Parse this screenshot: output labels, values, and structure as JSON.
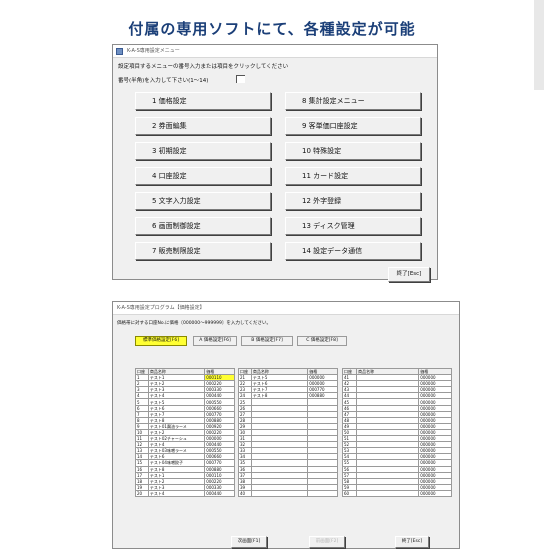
{
  "banner": "付属の専用ソフトにて、各種設定が可能",
  "menu_window": {
    "title": "K-A-S専用設定メニュー",
    "instruction": "設定項目するメニューの番号入力または項目をクリックしてください",
    "number_prompt": "番号(半角)を入力して下さい(1～14)",
    "number_value": "",
    "buttons": [
      {
        "label": "1 価格設定"
      },
      {
        "label": "8 集計設定メニュー"
      },
      {
        "label": "2 券面編集"
      },
      {
        "label": "9 客単価口座設定"
      },
      {
        "label": "3 初期設定"
      },
      {
        "label": "10 特殊設定"
      },
      {
        "label": "4 口座設定"
      },
      {
        "label": "11 カード設定"
      },
      {
        "label": "5 文字入力設定"
      },
      {
        "label": "12 外字登録"
      },
      {
        "label": "6 画面制御設定"
      },
      {
        "label": "13 ディスク管理"
      },
      {
        "label": "7 販売制限設定"
      },
      {
        "label": "14 設定データ通信"
      }
    ],
    "end_button": "終了[Esc]"
  },
  "price_window": {
    "title": "K-A-S専用設定プログラム【価格設定】",
    "instruction": "価格帯に対する口座No.に価格〔000000～999999〕を入力してください。",
    "tabs": [
      {
        "label": "標準価格設定[F6]",
        "active": true
      },
      {
        "label": "A 価格設定[F6]",
        "active": false
      },
      {
        "label": "B 価格設定[F7]",
        "active": false
      },
      {
        "label": "C 価格設定[F8]",
        "active": false
      }
    ],
    "header_label": "口座",
    "columns": [
      "口座",
      "商品名称",
      "価格"
    ],
    "table_left": [
      {
        "no": "1",
        "name": "テスト1",
        "price": "000110",
        "hl": true
      },
      {
        "no": "2",
        "name": "テスト2",
        "price": "000220"
      },
      {
        "no": "3",
        "name": "テスト3",
        "price": "000330"
      },
      {
        "no": "4",
        "name": "テスト4",
        "price": "000440"
      },
      {
        "no": "5",
        "name": "テスト5",
        "price": "000550"
      },
      {
        "no": "6",
        "name": "テスト6",
        "price": "000660"
      },
      {
        "no": "7",
        "name": "テスト7",
        "price": "000770"
      },
      {
        "no": "8",
        "name": "テスト8",
        "price": "000880"
      },
      {
        "no": "9",
        "name": "テスト01醤油ラーメ",
        "price": "000920"
      },
      {
        "no": "10",
        "name": "テスト2",
        "price": "000220"
      },
      {
        "no": "11",
        "name": "テスト02チャーシュ",
        "price": "000000"
      },
      {
        "no": "12",
        "name": "テスト4",
        "price": "000440"
      },
      {
        "no": "13",
        "name": "テスト03味噌ラーメ",
        "price": "000550"
      },
      {
        "no": "14",
        "name": "テスト6",
        "price": "000660"
      },
      {
        "no": "15",
        "name": "テスト04味噌餃子",
        "price": "000770"
      },
      {
        "no": "16",
        "name": "テスト8",
        "price": "000880"
      },
      {
        "no": "17",
        "name": "テスト1",
        "price": "000110"
      },
      {
        "no": "18",
        "name": "テスト2",
        "price": "000220"
      },
      {
        "no": "19",
        "name": "テスト3",
        "price": "000330"
      },
      {
        "no": "20",
        "name": "テスト4",
        "price": "000440"
      }
    ],
    "table_mid": [
      {
        "no": "21",
        "name": "テスト5",
        "price": "000000"
      },
      {
        "no": "22",
        "name": "テスト6",
        "price": "000000"
      },
      {
        "no": "23",
        "name": "テスト7",
        "price": "000770"
      },
      {
        "no": "24",
        "name": "テスト8",
        "price": "000880"
      },
      {
        "no": "25",
        "name": "",
        "price": ""
      },
      {
        "no": "26",
        "name": "",
        "price": ""
      },
      {
        "no": "27",
        "name": "",
        "price": ""
      },
      {
        "no": "28",
        "name": "",
        "price": ""
      },
      {
        "no": "29",
        "name": "",
        "price": ""
      },
      {
        "no": "30",
        "name": "",
        "price": ""
      },
      {
        "no": "31",
        "name": "",
        "price": ""
      },
      {
        "no": "32",
        "name": "",
        "price": ""
      },
      {
        "no": "33",
        "name": "",
        "price": ""
      },
      {
        "no": "34",
        "name": "",
        "price": ""
      },
      {
        "no": "35",
        "name": "",
        "price": ""
      },
      {
        "no": "36",
        "name": "",
        "price": ""
      },
      {
        "no": "37",
        "name": "",
        "price": ""
      },
      {
        "no": "38",
        "name": "",
        "price": ""
      },
      {
        "no": "39",
        "name": "",
        "price": ""
      },
      {
        "no": "40",
        "name": "",
        "price": ""
      }
    ],
    "table_right": [
      {
        "no": "41",
        "name": "",
        "price": "000000"
      },
      {
        "no": "42",
        "name": "",
        "price": "000000"
      },
      {
        "no": "43",
        "name": "",
        "price": "000000"
      },
      {
        "no": "44",
        "name": "",
        "price": "000000"
      },
      {
        "no": "45",
        "name": "",
        "price": "000000"
      },
      {
        "no": "46",
        "name": "",
        "price": "000000"
      },
      {
        "no": "47",
        "name": "",
        "price": "000000"
      },
      {
        "no": "48",
        "name": "",
        "price": "000000"
      },
      {
        "no": "49",
        "name": "",
        "price": "000000"
      },
      {
        "no": "50",
        "name": "",
        "price": "000000"
      },
      {
        "no": "51",
        "name": "",
        "price": "000000"
      },
      {
        "no": "52",
        "name": "",
        "price": "000000"
      },
      {
        "no": "53",
        "name": "",
        "price": "000000"
      },
      {
        "no": "54",
        "name": "",
        "price": "000000"
      },
      {
        "no": "55",
        "name": "",
        "price": "000000"
      },
      {
        "no": "56",
        "name": "",
        "price": "000000"
      },
      {
        "no": "57",
        "name": "",
        "price": "000000"
      },
      {
        "no": "58",
        "name": "",
        "price": "000000"
      },
      {
        "no": "59",
        "name": "",
        "price": "000000"
      },
      {
        "no": "60",
        "name": "",
        "price": "000000"
      }
    ],
    "next_button": "次画面[F1]",
    "prev_button": "前画面[F2]",
    "end_button": "終了[Esc]"
  }
}
